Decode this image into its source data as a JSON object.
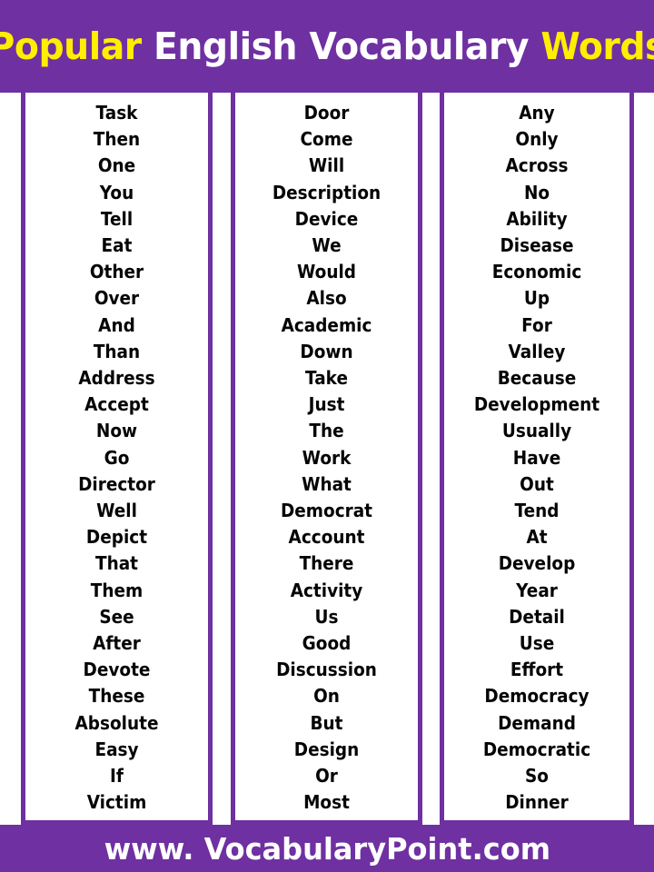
{
  "header": {
    "title_parts": [
      {
        "text": "Popular",
        "style": "accent"
      },
      {
        "text": " English Vocabulary ",
        "style": "plain"
      },
      {
        "text": "Words",
        "style": "accent"
      }
    ],
    "title_full": "Popular English Vocabulary Words",
    "background_color": "#6f30a2",
    "accent_color": "#ffee00",
    "plain_color": "#ffffff"
  },
  "columns": [
    {
      "id": "column-1",
      "words": [
        "Task",
        "Then",
        "One",
        "You",
        "Tell",
        "Eat",
        "Other",
        "Over",
        "And",
        "Than",
        "Address",
        "Accept",
        "Now",
        "Go",
        "Director",
        "Well",
        "Depict",
        "That",
        "Them",
        "See",
        "After",
        "Devote",
        "These",
        "Absolute",
        "Easy",
        "If",
        "Victim"
      ]
    },
    {
      "id": "column-2",
      "words": [
        "Door",
        "Come",
        "Will",
        "Description",
        "Device",
        "We",
        "Would",
        "Also",
        "Academic",
        "Down",
        "Take",
        "Just",
        "The",
        "Work",
        "What",
        "Democrat",
        "Account",
        "There",
        "Activity",
        "Us",
        "Good",
        "Discussion",
        "On",
        "But",
        "Design",
        "Or",
        "Most"
      ]
    },
    {
      "id": "column-3",
      "words": [
        "Any",
        "Only",
        "Across",
        "No",
        "Ability",
        "Disease",
        "Economic",
        "Up",
        "For",
        "Valley",
        "Because",
        "Development",
        "Usually",
        "Have",
        "Out",
        "Tend",
        "At",
        "Develop",
        "Year",
        "Detail",
        "Use",
        "Effort",
        "Democracy",
        "Demand",
        "Democratic",
        "So",
        "Dinner"
      ]
    }
  ],
  "footer": {
    "text": "www. VocabularyPoint.com",
    "background_color": "#6f30a2",
    "text_color": "#ffffff"
  },
  "theme": {
    "purple": "#6f30a2",
    "yellow": "#ffee00",
    "white": "#ffffff",
    "text_black": "#050505"
  }
}
